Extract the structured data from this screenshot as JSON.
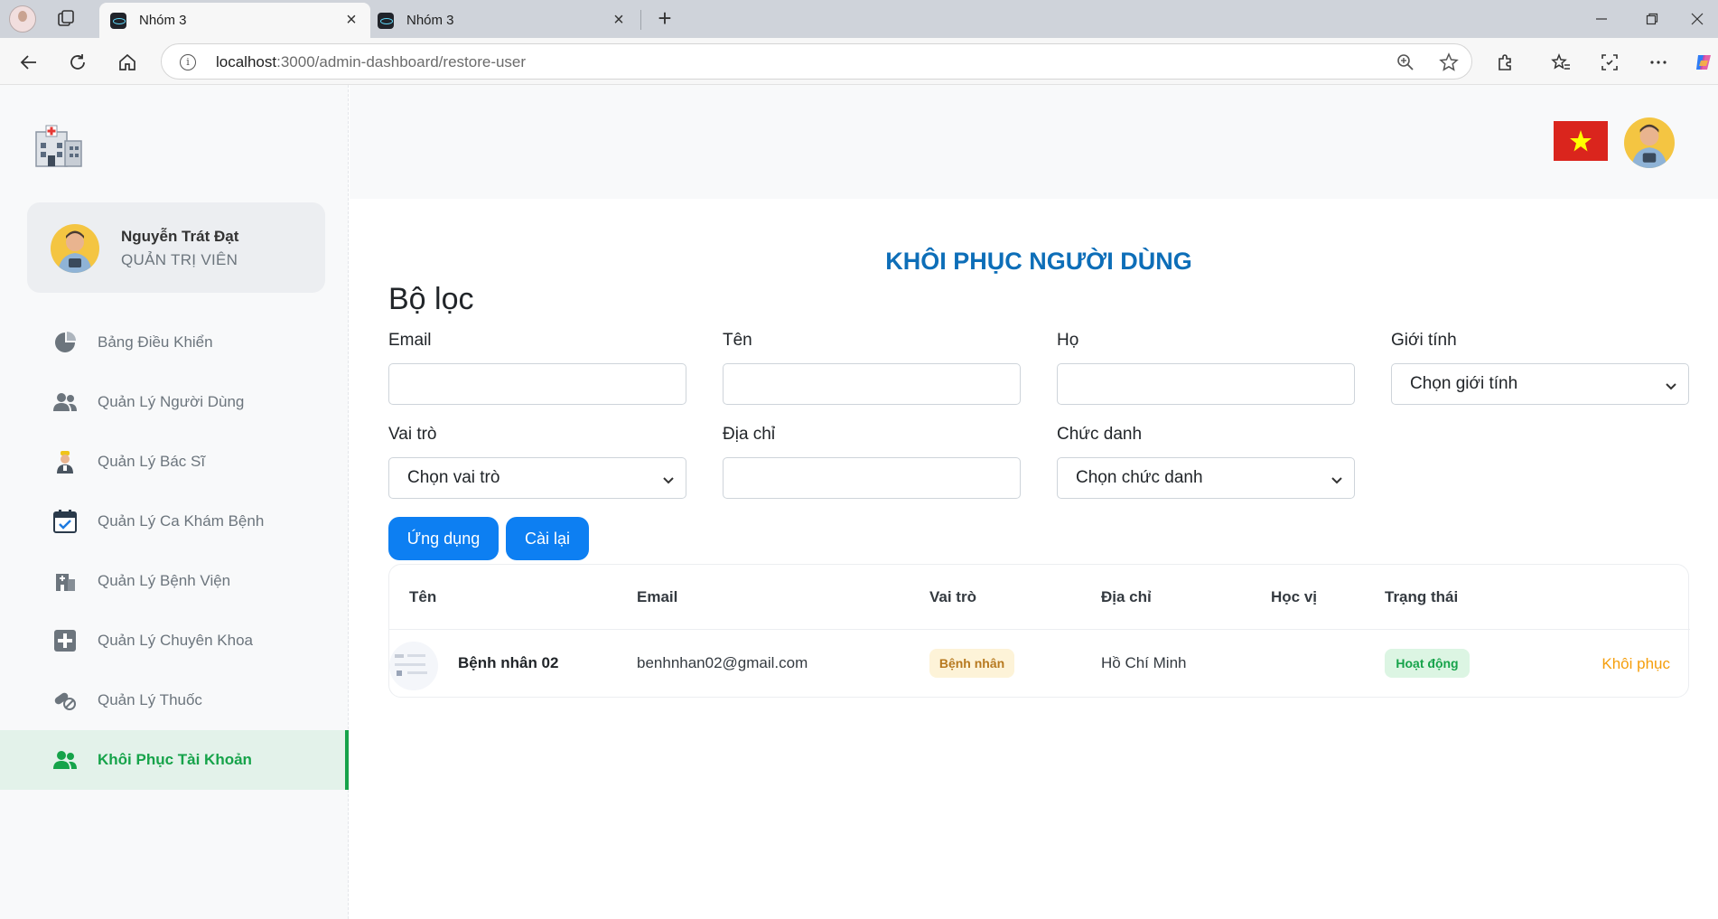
{
  "browser": {
    "tabs": [
      {
        "title": "Nhóm 3",
        "active": true
      },
      {
        "title": "Nhóm 3",
        "active": false
      }
    ],
    "url_host": "localhost",
    "url_path": ":3000/admin-dashboard/restore-user"
  },
  "sidebar": {
    "user": {
      "name": "Nguyễn Trát Đạt",
      "role": "QUẢN TRỊ VIÊN"
    },
    "items": [
      {
        "label": "Bảng Điều Khiển",
        "icon": "pie-chart-icon"
      },
      {
        "label": "Quản Lý Người Dùng",
        "icon": "users-icon"
      },
      {
        "label": "Quản Lý Bác Sĩ",
        "icon": "doctor-icon"
      },
      {
        "label": "Quản Lý Ca Khám Bệnh",
        "icon": "calendar-check-icon"
      },
      {
        "label": "Quản Lý Bệnh Viện",
        "icon": "hospital-icon"
      },
      {
        "label": "Quản Lý Chuyên Khoa",
        "icon": "medical-cross-icon"
      },
      {
        "label": "Quản Lý Thuốc",
        "icon": "pills-icon"
      },
      {
        "label": "Khôi Phục Tài Khoản",
        "icon": "users-icon",
        "active": true
      }
    ]
  },
  "page": {
    "title": "KHÔI PHỤC NGƯỜI DÙNG",
    "filter_title": "Bộ lọc"
  },
  "filters": {
    "email_label": "Email",
    "first_name_label": "Tên",
    "last_name_label": "Họ",
    "gender_label": "Giới tính",
    "gender_value": "Chọn giới tính",
    "role_label": "Vai trò",
    "role_value": "Chọn vai trò",
    "address_label": "Địa chỉ",
    "position_label": "Chức danh",
    "position_value": "Chọn chức danh",
    "apply_label": "Ứng dụng",
    "reset_label": "Cài lại"
  },
  "table": {
    "headers": [
      "Tên",
      "Email",
      "Vai trò",
      "Địa chỉ",
      "Học vị",
      "Trạng thái"
    ],
    "rows": [
      {
        "name": "Bệnh nhân 02",
        "email": "benhnhan02@gmail.com",
        "role": "Bệnh nhân",
        "address": "Hồ Chí Minh",
        "degree": "",
        "status": "Hoạt động",
        "action": "Khôi phục"
      }
    ]
  },
  "colors": {
    "title_blue": "#0d6eb8",
    "button_blue": "#0d7ff2",
    "active_green": "#16a34a",
    "restore_orange": "#f59e0b",
    "role_badge_bg": "#fdf3d8",
    "status_badge_bg": "#dcf5e3"
  }
}
